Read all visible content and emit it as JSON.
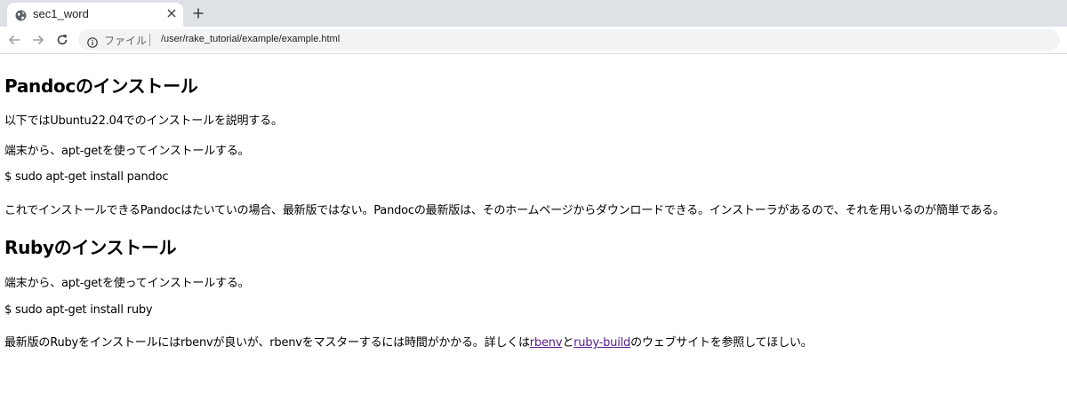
{
  "browser": {
    "tab_title": "sec1_word",
    "security_label": "ファイル",
    "url": "/user/rake_tutorial/example/example.html"
  },
  "document": {
    "section1": {
      "heading": "Pandocのインストール",
      "p1": "以下ではUbuntu22.04でのインストールを説明する。",
      "p2": "端末から、apt-getを使ってインストールする。",
      "code": "$ sudo apt-get install pandoc",
      "p3": "これでインストールできるPandocはたいていの場合、最新版ではない。Pandocの最新版は、そのホームページからダウンロードできる。インストーラがあるので、それを用いるのが簡単である。"
    },
    "section2": {
      "heading": "Rubyのインストール",
      "p1": "端末から、apt-getを使ってインストールする。",
      "code": "$ sudo apt-get install ruby",
      "p2_before": "最新版のRubyをインストールにはrbenvが良いが、rbenvをマスターするには時間がかかる。詳しくは",
      "link1": "rbenv",
      "p2_between": "と",
      "link2": "ruby-build",
      "p2_after": "のウェブサイトを参照してほしい。"
    }
  },
  "colors": {
    "tabbar_bg": "#dee1e6",
    "link_visited": "#551a8b"
  },
  "icons": {
    "favicon": "globe-icon",
    "close": "close-icon",
    "new_tab": "plus-icon",
    "back": "back-arrow-icon",
    "forward": "forward-arrow-icon",
    "reload": "reload-icon",
    "info": "info-icon"
  }
}
